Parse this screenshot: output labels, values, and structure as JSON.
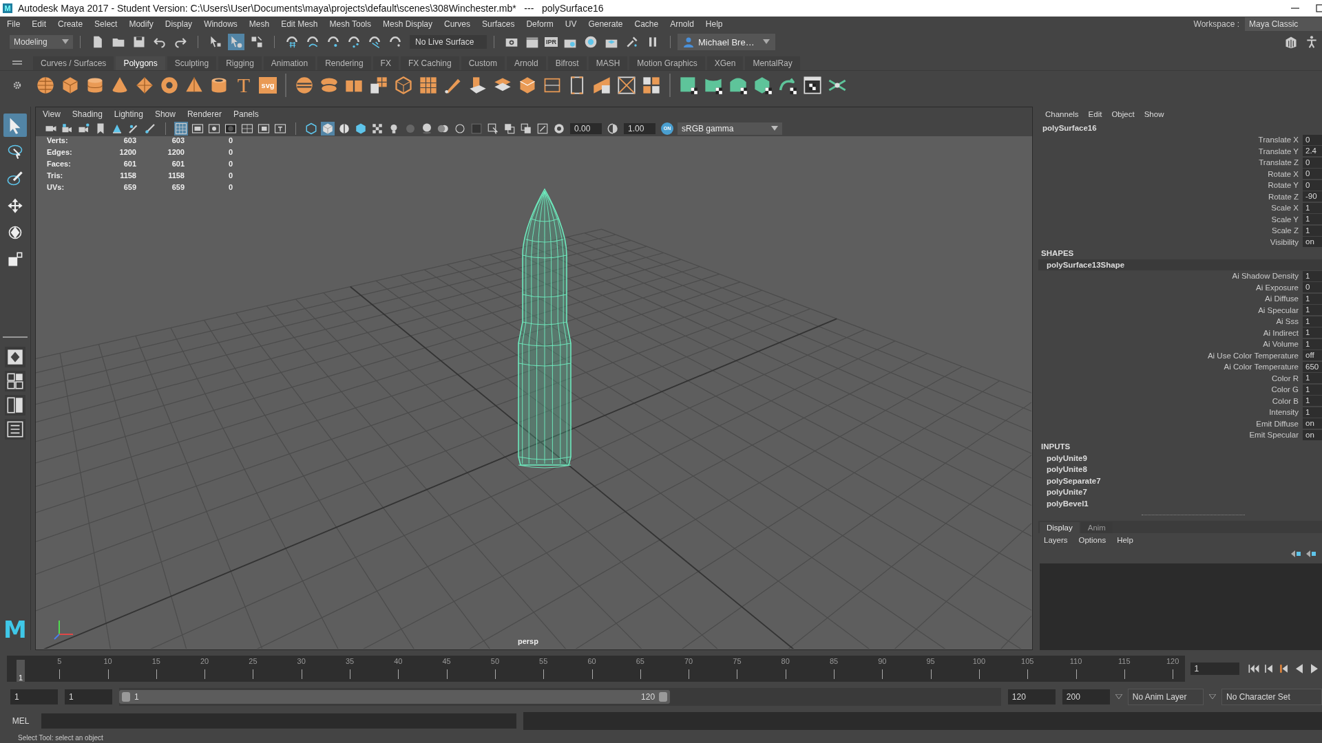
{
  "title_bar": {
    "app_icon": "M",
    "title": "Autodesk Maya 2017 - Student Version: C:\\Users\\User\\Documents\\maya\\projects\\default\\scenes\\308Winchester.mb*   ---   polySurface16"
  },
  "menu_bar": [
    "File",
    "Edit",
    "Create",
    "Select",
    "Modify",
    "Display",
    "Windows",
    "Mesh",
    "Edit Mesh",
    "Mesh Tools",
    "Mesh Display",
    "Curves",
    "Surfaces",
    "Deform",
    "UV",
    "Generate",
    "Cache",
    "Arnold",
    "Help"
  ],
  "workspace": {
    "label": "Workspace :",
    "value": "Maya Classic"
  },
  "status_line": {
    "mode": "Modeling",
    "live_surface": "No Live Surface",
    "ipr": "IPR",
    "user": "Michael Bre…"
  },
  "shelf": {
    "tabs": [
      {
        "label": "Curves / Surfaces",
        "selected": false
      },
      {
        "label": "Polygons",
        "selected": true
      },
      {
        "label": "Sculpting",
        "selected": false
      },
      {
        "label": "Rigging",
        "selected": false
      },
      {
        "label": "Animation",
        "selected": false
      },
      {
        "label": "Rendering",
        "selected": false
      },
      {
        "label": "FX",
        "selected": false
      },
      {
        "label": "FX Caching",
        "selected": false
      },
      {
        "label": "Custom",
        "selected": false
      },
      {
        "label": "Arnold",
        "selected": false
      },
      {
        "label": "Bifrost",
        "selected": false
      },
      {
        "label": "MASH",
        "selected": false
      },
      {
        "label": "Motion Graphics",
        "selected": false
      },
      {
        "label": "XGen",
        "selected": false
      },
      {
        "label": "MentalRay",
        "selected": false
      }
    ],
    "text_tool": "T",
    "svg_tool": "svg"
  },
  "toolbox": {
    "tools": [
      {
        "selected": true
      },
      {
        "selected": false
      },
      {
        "selected": false
      },
      {
        "selected": false
      },
      {
        "selected": false
      },
      {
        "selected": false
      }
    ],
    "logo": "M"
  },
  "viewport": {
    "menus": [
      "View",
      "Shading",
      "Lighting",
      "Show",
      "Renderer",
      "Panels"
    ],
    "exposure": "0.00",
    "gamma": "1.00",
    "color_management": "ON",
    "color_space": "sRGB gamma",
    "stats": [
      {
        "label": "Verts:",
        "values": [
          "603",
          "603",
          "0"
        ]
      },
      {
        "label": "Edges:",
        "values": [
          "1200",
          "1200",
          "0"
        ]
      },
      {
        "label": "Faces:",
        "values": [
          "601",
          "601",
          "0"
        ]
      },
      {
        "label": "Tris:",
        "values": [
          "1158",
          "1158",
          "0"
        ]
      },
      {
        "label": "UVs:",
        "values": [
          "659",
          "659",
          "0"
        ]
      }
    ],
    "camera": "persp"
  },
  "channel_box": {
    "menus": [
      "Channels",
      "Edit",
      "Object",
      "Show"
    ],
    "object_name": "polySurface16",
    "channels": [
      {
        "name": "Translate X",
        "value": "0"
      },
      {
        "name": "Translate Y",
        "value": "2.4"
      },
      {
        "name": "Translate Z",
        "value": "0"
      },
      {
        "name": "Rotate X",
        "value": "0"
      },
      {
        "name": "Rotate Y",
        "value": "0"
      },
      {
        "name": "Rotate Z",
        "value": "-90"
      },
      {
        "name": "Scale X",
        "value": "1"
      },
      {
        "name": "Scale Y",
        "value": "1"
      },
      {
        "name": "Scale Z",
        "value": "1"
      },
      {
        "name": "Visibility",
        "value": "on"
      }
    ],
    "shapes_header": "SHAPES",
    "shape_name": "polySurface13Shape",
    "shape_channels": [
      {
        "name": "Ai Shadow Density",
        "value": "1"
      },
      {
        "name": "Ai Exposure",
        "value": "0"
      },
      {
        "name": "Ai Diffuse",
        "value": "1"
      },
      {
        "name": "Ai Specular",
        "value": "1"
      },
      {
        "name": "Ai Sss",
        "value": "1"
      },
      {
        "name": "Ai Indirect",
        "value": "1"
      },
      {
        "name": "Ai Volume",
        "value": "1"
      },
      {
        "name": "Ai Use Color Temperature",
        "value": "off"
      },
      {
        "name": "Ai Color Temperature",
        "value": "650"
      },
      {
        "name": "Color R",
        "value": "1"
      },
      {
        "name": "Color G",
        "value": "1"
      },
      {
        "name": "Color B",
        "value": "1"
      },
      {
        "name": "Intensity",
        "value": "1"
      },
      {
        "name": "Emit Diffuse",
        "value": "on"
      },
      {
        "name": "Emit Specular",
        "value": "on"
      }
    ],
    "inputs_header": "INPUTS",
    "inputs": [
      "polyUnite9",
      "polyUnite8",
      "polySeparate7",
      "polyUnite7",
      "polyBevel1"
    ]
  },
  "layer_editor": {
    "tabs": [
      {
        "label": "Display",
        "selected": true
      },
      {
        "label": "Anim",
        "selected": false
      }
    ],
    "menus": [
      "Layers",
      "Options",
      "Help"
    ]
  },
  "timeline": {
    "current_frame": "1",
    "level": 0,
    "tick_labels": [
      "5",
      "10",
      "15",
      "20",
      "25",
      "30",
      "35",
      "40",
      "45",
      "50",
      "55",
      "60",
      "65",
      "70",
      "75",
      "80",
      "85",
      "90",
      "95",
      "100",
      "105",
      "110",
      "115",
      "120"
    ],
    "current_time": "1"
  },
  "range_slider": {
    "start_time": "1",
    "playback_start": "1",
    "range_start": "1",
    "range_end": "120",
    "playback_end": "120",
    "end_time": "200",
    "anim_layer": "No Anim Layer",
    "character_set": "No Character Set"
  },
  "command_line": {
    "language": "MEL"
  },
  "help_line": "Select Tool: select an object"
}
